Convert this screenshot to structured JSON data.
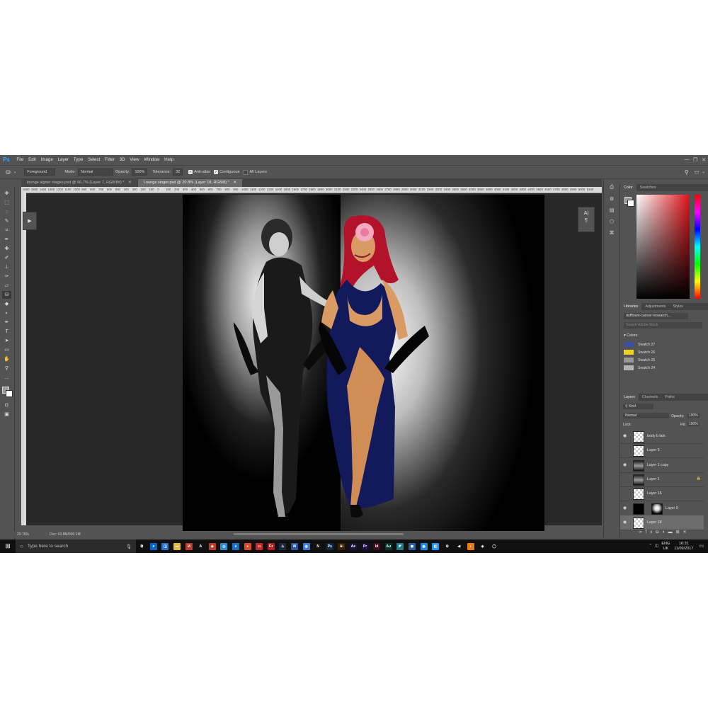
{
  "app": {
    "logo": "Ps",
    "menu": [
      "File",
      "Edit",
      "Image",
      "Layer",
      "Type",
      "Select",
      "Filter",
      "3D",
      "View",
      "Window",
      "Help"
    ],
    "window_controls": [
      "—",
      "❐",
      "✕"
    ]
  },
  "options_bar": {
    "tool_icon": "paint-bucket-icon",
    "fill_source": "Foreground",
    "mode_label": "Mode:",
    "mode_value": "Normal",
    "opacity_label": "Opacity:",
    "opacity_value": "100%",
    "tolerance_label": "Tolerance:",
    "tolerance_value": "32",
    "anti_alias": "Anti-alias",
    "contiguous": "Contiguous",
    "all_layers": "All Layers"
  },
  "tabs": [
    {
      "label": "lounge signer stages.psd @ 66.7% (Layer 7, RGB/8#) *",
      "close": "✕"
    },
    {
      "label": "Lounge singer.psd @ 20.8% (Layer 18, RGB/8) *",
      "close": "✕"
    }
  ],
  "ruler_ticks": [
    "1600",
    "1500",
    "1400",
    "1300",
    "1200",
    "1100",
    "1000",
    "900",
    "800",
    "700",
    "600",
    "500",
    "400",
    "300",
    "200",
    "100",
    "0",
    "100",
    "200",
    "300",
    "400",
    "500",
    "600",
    "700",
    "800",
    "900",
    "1000",
    "1100",
    "1200",
    "1300",
    "1400",
    "1500",
    "1600",
    "1700",
    "1800",
    "1900",
    "2000",
    "2100",
    "2200",
    "2300",
    "2400",
    "2500",
    "2600",
    "2700",
    "2800",
    "2900",
    "3000",
    "3100",
    "3200",
    "3300",
    "3400",
    "3500",
    "3600",
    "3700",
    "3800",
    "3900",
    "4000",
    "4100",
    "4200",
    "4300",
    "4400",
    "4500",
    "4600",
    "4700",
    "4800",
    "4900",
    "5000",
    "5100"
  ],
  "status": {
    "zoom": "20.76%",
    "doc": "Doc: 63.8M/500.1M"
  },
  "color_panel": {
    "tabs": [
      "Color",
      "Swatches"
    ]
  },
  "libraries_panel": {
    "tabs": [
      "Libraries",
      "Adjustments",
      "Styles"
    ],
    "library": "dufftown-cancer-research...",
    "search_placeholder": "Search Adobe Stock",
    "colors_heading": "Colors",
    "swatches": [
      {
        "name": "Swatch 27",
        "color": "#3c4ea0"
      },
      {
        "name": "Swatch 26",
        "color": "#f0d21c"
      },
      {
        "name": "Swatch 25",
        "color": "#9a9a9a"
      },
      {
        "name": "Swatch 24",
        "color": "#b4b4b4"
      }
    ]
  },
  "layers_panel": {
    "tabs": [
      "Layers",
      "Channels",
      "Paths"
    ],
    "kind": "Kind",
    "blend": "Normal",
    "opacity_label": "Opacity:",
    "opacity_value": "100%",
    "lock_label": "Lock:",
    "fill_label": "Fill:",
    "fill_value": "100%",
    "layers": [
      {
        "name": "body b lain",
        "visible": true,
        "thumb": "transparent"
      },
      {
        "name": "Layer 5",
        "visible": false,
        "thumb": "transparent"
      },
      {
        "name": "Layer 1 copy",
        "visible": true,
        "thumb": "photo"
      },
      {
        "name": "Layer 1",
        "visible": false,
        "thumb": "photo",
        "locked": true
      },
      {
        "name": "Layer 16",
        "visible": false,
        "thumb": "transparent"
      },
      {
        "name": "Layer 0",
        "visible": true,
        "thumb": "black",
        "mask": true
      },
      {
        "name": "Layer 18",
        "visible": true,
        "thumb": "transparent",
        "selected": true
      }
    ]
  },
  "taskbar": {
    "search_placeholder": "Type here to search",
    "apps": [
      {
        "name": "task-view",
        "label": "⧉",
        "color": "#101010"
      },
      {
        "name": "edge",
        "label": "e",
        "color": "#0a64c8"
      },
      {
        "name": "store",
        "label": "◫",
        "color": "#2e6fcc"
      },
      {
        "name": "explorer",
        "label": "▬",
        "color": "#e8b83a"
      },
      {
        "name": "mail",
        "label": "M",
        "color": "#c0392b"
      },
      {
        "name": "acrobat",
        "label": "A",
        "color": "#111"
      },
      {
        "name": "app-red",
        "label": "◆",
        "color": "#c0392b"
      },
      {
        "name": "chrome-blue",
        "label": "◎",
        "color": "#2a8cd8"
      },
      {
        "name": "ie",
        "label": "e",
        "color": "#1a6cc8"
      },
      {
        "name": "chrome",
        "label": "●",
        "color": "#d84a2a"
      },
      {
        "name": "screen",
        "label": "▭",
        "color": "#c62828"
      },
      {
        "name": "filezilla",
        "label": "Fz",
        "color": "#b71c1c"
      },
      {
        "name": "steam",
        "label": "♨",
        "color": "#1b2838"
      },
      {
        "name": "word",
        "label": "W",
        "color": "#2b579a"
      },
      {
        "name": "browser",
        "label": "◍",
        "color": "#3a7bd5"
      },
      {
        "name": "netflix",
        "label": "N",
        "color": "#111"
      },
      {
        "name": "photoshop",
        "label": "Ps",
        "color": "#0f2a44"
      },
      {
        "name": "illustrator",
        "label": "Ai",
        "color": "#3a1f00"
      },
      {
        "name": "after-effects",
        "label": "Ae",
        "color": "#1a1040"
      },
      {
        "name": "premiere",
        "label": "Pr",
        "color": "#1e0a3c"
      },
      {
        "name": "indesign",
        "label": "Id",
        "color": "#3d0a22"
      },
      {
        "name": "audition",
        "label": "Au",
        "color": "#04332b"
      },
      {
        "name": "app-1",
        "label": "◤",
        "color": "#1f7a8c"
      },
      {
        "name": "app-2",
        "label": "◼",
        "color": "#2c5f9e"
      },
      {
        "name": "app-3",
        "label": "◉",
        "color": "#1e88e5"
      },
      {
        "name": "app-4",
        "label": "◧",
        "color": "#2196f3"
      },
      {
        "name": "settings",
        "label": "⚙",
        "color": "#101010"
      },
      {
        "name": "app-5",
        "label": "◀",
        "color": "#101010"
      },
      {
        "name": "blender",
        "label": "◐",
        "color": "#e87d0d"
      },
      {
        "name": "app-6",
        "label": "◈",
        "color": "#101010"
      },
      {
        "name": "app-7",
        "label": "◯",
        "color": "#101010"
      }
    ],
    "lang": "ENG",
    "region": "UK",
    "time": "16:31",
    "date": "11/09/2017"
  }
}
